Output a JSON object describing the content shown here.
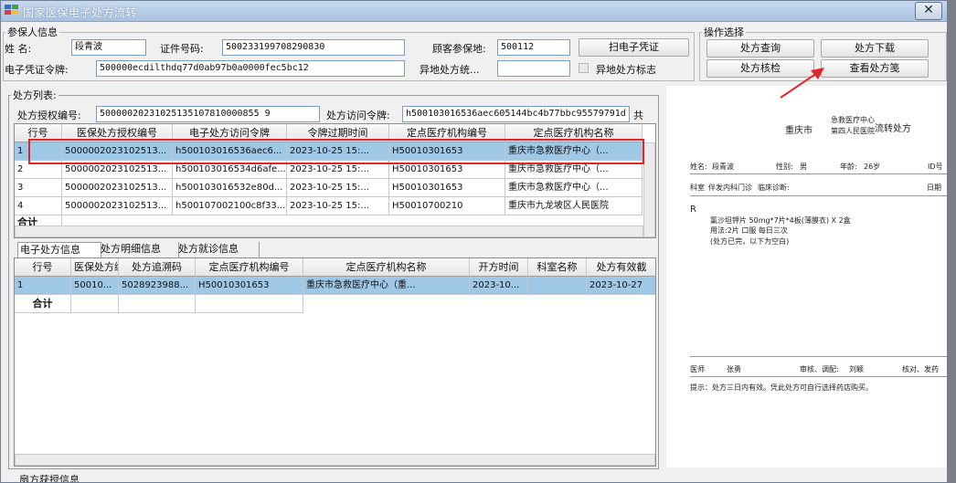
{
  "window": {
    "title": "国家医保电子处方流转",
    "close_glyph": "✕"
  },
  "insured": {
    "legend": "参保人信息",
    "name_label": "姓  名:",
    "name_value": "段青波",
    "id_label": "证件号码:",
    "id_value": "500233199708290830",
    "area_label": "顾客参保地:",
    "area_value": "500112",
    "scan_btn": "扫电子凭证",
    "token_label": "电子凭证令牌:",
    "token_value": "500000ecdilthdq77d0ab97b0a0000fec5bc12",
    "remote_label": "异地处方统...",
    "remote_value": "",
    "remote_flag_label": "异地处方标志"
  },
  "ops": {
    "legend": "操作选择",
    "query": "处方查询",
    "download": "处方下载",
    "verify": "处方核检",
    "view": "查看处方笺"
  },
  "rxlist": {
    "legend": "处方列表:",
    "auth_label": "处方授权编号:",
    "auth_value": "50000020231025135107810000855 9",
    "visit_label": "处方访问令牌:",
    "visit_value": "h500103016536aec605144bc4b77bbc95579791d",
    "total_label": "共",
    "columns": [
      "行号",
      "医保处方授权编号",
      "电子处方访问令牌",
      "令牌过期时间",
      "定点医疗机构编号",
      "定点医疗机构名称"
    ],
    "rows": [
      [
        "1",
        "5000002023102513...",
        "h500103016536aec6...",
        "2023-10-25 15:...",
        "H50010301653",
        "重庆市急救医疗中心（..."
      ],
      [
        "2",
        "5000002023102513...",
        "h500103016534d6afe...",
        "2023-10-25 15:...",
        "H50010301653",
        "重庆市急救医疗中心（..."
      ],
      [
        "3",
        "5000002023102513...",
        "h500103016532e80d...",
        "2023-10-25 15:...",
        "H50010301653",
        "重庆市急救医疗中心（..."
      ],
      [
        "4",
        "5000002023102513...",
        "h500107002100c8f33...",
        "2023-10-25 15:...",
        "H50010700210",
        "重庆市九龙坡区人民医院"
      ]
    ],
    "total_row": "合计"
  },
  "tabs": [
    "电子处方信息",
    "处方明细信息",
    "处方就诊信息"
  ],
  "detail": {
    "columns": [
      "行号",
      "医保处方编",
      "处方追溯码",
      "定点医疗机构编号",
      "定点医疗机构名称",
      "开方时间",
      "科室名称",
      "处方有效截"
    ],
    "rows": [
      [
        "1",
        "50010...",
        "5028923988...",
        "H50010301653",
        "重庆市急救医疗中心（重...",
        "2023-10...",
        "",
        "2023-10-27"
      ]
    ],
    "total_row": "合计"
  },
  "prescription": {
    "city": "重庆市",
    "hospital_line1": "急救医疗中心",
    "hospital_line2": "第四人民医院",
    "type": "流转处方",
    "name_label": "姓名:",
    "name": "段青波",
    "sex_label": "性别:",
    "sex": "男",
    "age_label": "年龄:",
    "age": "26岁",
    "id_label": "ID号",
    "dept_label": "科室",
    "dept": "伴发内科门诊",
    "diag_label": "临床诊断:",
    "date_label": "日期",
    "r_mark": "R",
    "drug": "氯沙坦钾片 50mg*7片*4板(薄膜衣) X 2盒",
    "usage": "用法:2片  口服  每日三次",
    "end_note": "(处方已完，以下为空白)",
    "doctor_label": "医师",
    "doctor": "张勇",
    "review_label": "审核、调配:",
    "reviewer": "刘颖",
    "check_label": "核对、发药",
    "tip": "提示：处方三日内有效。凭此处方可自行选择药店购买。"
  },
  "colors": {
    "selected_row": "#9fc8e6",
    "highlight_box": "#e0262c",
    "arrow": "#e0262c"
  },
  "bottom_label": "扇方获授信息"
}
